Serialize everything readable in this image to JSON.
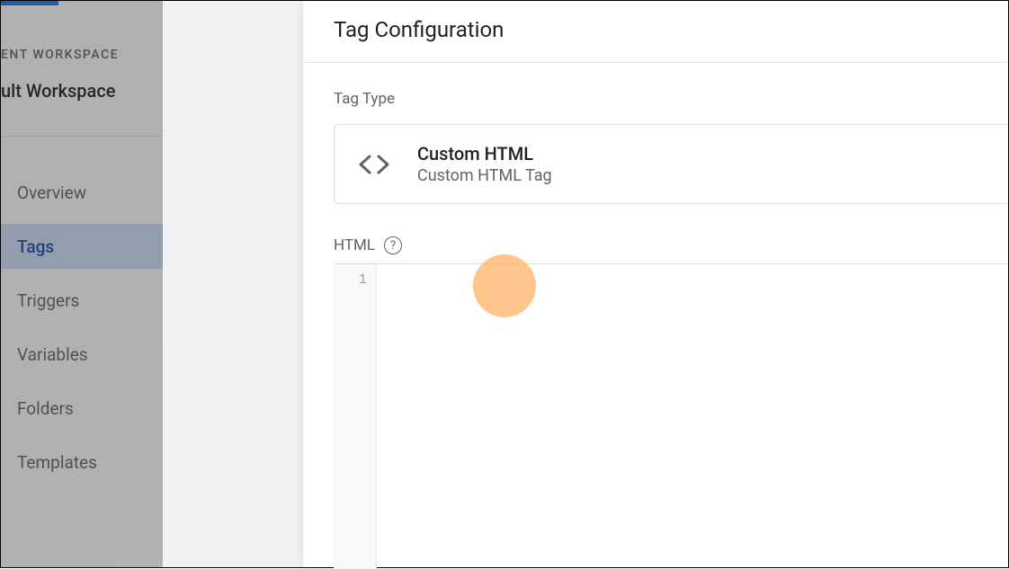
{
  "sidebar": {
    "workspace_header": "ENT WORKSPACE",
    "workspace_name": "ult Workspace",
    "nav": {
      "overview": "Overview",
      "tags": "Tags",
      "triggers": "Triggers",
      "variables": "Variables",
      "folders": "Folders",
      "templates": "Templates"
    }
  },
  "modal": {
    "title": "Tag Configuration",
    "tag_type_label": "Tag Type",
    "tag_type": {
      "title": "Custom HTML",
      "subtitle": "Custom HTML Tag"
    },
    "html_label": "HTML",
    "help_glyph": "?",
    "editor": {
      "line1": "1",
      "content": ""
    }
  }
}
